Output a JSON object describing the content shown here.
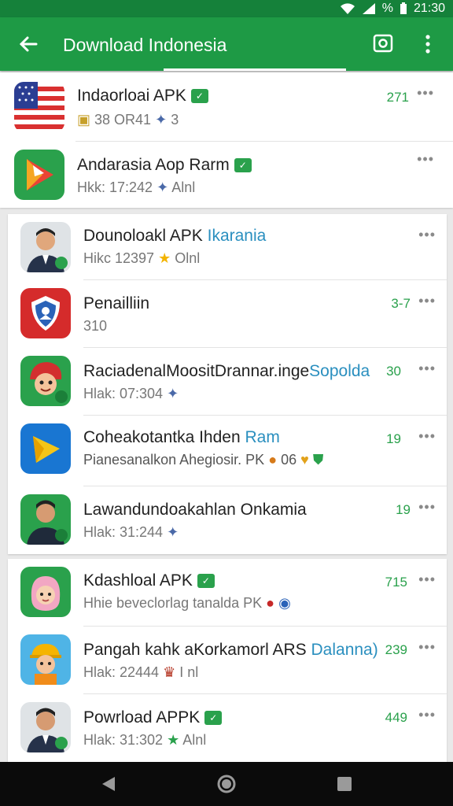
{
  "status": {
    "battery": "%",
    "time": "21:30"
  },
  "appbar": {
    "title": "Download Indonesia"
  },
  "items": [
    {
      "name": "Indaorloai APK",
      "sub": "38 OR41",
      "extra": "3",
      "rating": "271"
    },
    {
      "name": "Andarasia Aop Rarm",
      "sub": "Hkk: 17:242",
      "extra": "Alnl",
      "rating": ""
    },
    {
      "name": "Dounoloakl APK",
      "name_accent": "Ikarania",
      "sub": "Hikc 12397",
      "extra": "Olnl",
      "rating": ""
    },
    {
      "name": "Penailliin",
      "sub": "310",
      "extra": "",
      "rating": "3-7"
    },
    {
      "name": "RaciadenalMoositDrannar.inge",
      "name_accent": "Sopolda",
      "sub": "Hlak: 07:304",
      "extra": "",
      "rating": "30"
    },
    {
      "name": "Coheakotantka Ihden",
      "name_accent": "Ram",
      "sub": "Pianesanalkon Ahegiosir. PK",
      "extra": "06",
      "rating": "19"
    },
    {
      "name": "Lawandundoakahlan Onkamia",
      "sub": "Hlak: 31:244",
      "extra": "",
      "rating": "19"
    },
    {
      "name": "Kdashloal APK",
      "sub": "Hhie beveclorlag tanalda PK",
      "extra": "",
      "rating": "715"
    },
    {
      "name": "Pangah kahk aKorkamorl ARS",
      "name_accent": "Dalanna)",
      "sub": "Hlak: 22444",
      "extra": "I nl",
      "rating": "239"
    },
    {
      "name": "Powrload APPK",
      "sub": "Hlak: 31:302",
      "extra": "Alnl",
      "rating": "449"
    }
  ],
  "icons": [
    "flag-icon",
    "play-icon",
    "avatar-icon",
    "shield-icon",
    "character-icon",
    "play-yellow-icon",
    "avatar-icon",
    "girl-icon",
    "worker-icon",
    "avatar-icon"
  ],
  "colors": {
    "primary": "#1e9a45",
    "statusbar": "#15813a",
    "accent": "#2aa14c"
  }
}
